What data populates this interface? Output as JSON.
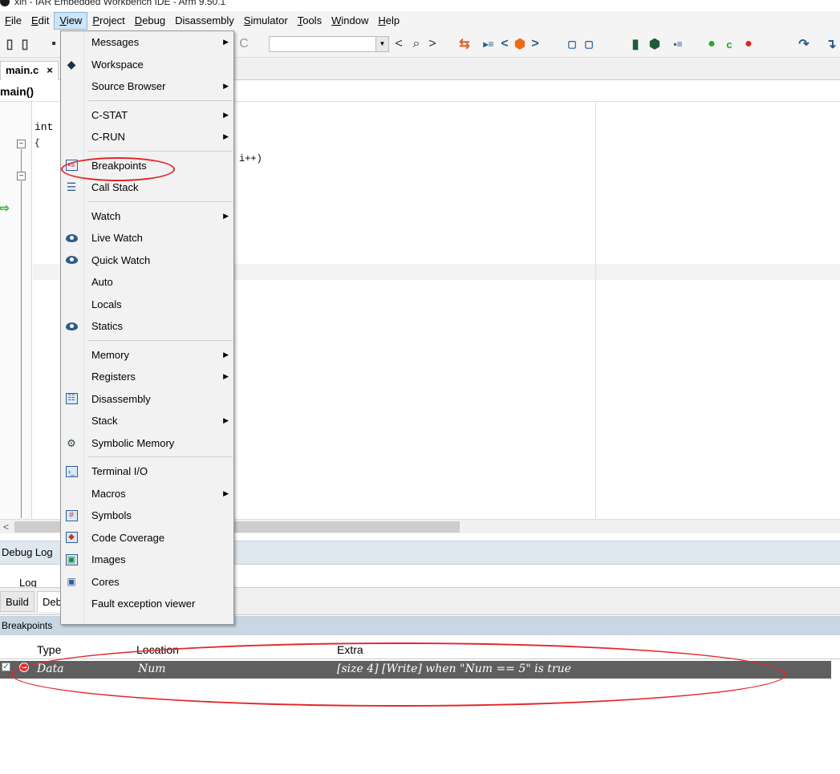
{
  "window": {
    "title": "xin - IAR Embedded Workbench IDE - Arm 9.50.1"
  },
  "menubar": [
    {
      "label": "File",
      "ul": "F",
      "rest": "ile",
      "active": false
    },
    {
      "label": "Edit",
      "ul": "E",
      "rest": "dit",
      "active": false
    },
    {
      "label": "View",
      "ul": "V",
      "rest": "iew",
      "active": true
    },
    {
      "label": "Project",
      "ul": "P",
      "rest": "roject",
      "active": false
    },
    {
      "label": "Debug",
      "ul": "D",
      "rest": "ebug",
      "active": false
    },
    {
      "label": "Disassembly",
      "ul": "",
      "rest": "Disassembly",
      "active": false
    },
    {
      "label": "Simulator",
      "ul": "S",
      "rest": "imulator",
      "active": false
    },
    {
      "label": "Tools",
      "ul": "T",
      "rest": "ools",
      "active": false
    },
    {
      "label": "Window",
      "ul": "W",
      "rest": "indow",
      "active": false
    },
    {
      "label": "Help",
      "ul": "H",
      "rest": "elp",
      "active": false
    }
  ],
  "editor": {
    "file_tab": "main.c",
    "close_glyph": "×",
    "function_scope": "main()",
    "code_int": "int",
    "code_brace": "{",
    "code_loop_tail": "i++)"
  },
  "view_menu": [
    {
      "label": "Messages",
      "submenu": true,
      "icon": ""
    },
    {
      "label": "Workspace",
      "submenu": false,
      "icon": "workspace-icon"
    },
    {
      "label": "Source Browser",
      "submenu": true,
      "icon": ""
    },
    {
      "sep": true
    },
    {
      "label": "C-STAT",
      "submenu": true,
      "icon": ""
    },
    {
      "label": "C-RUN",
      "submenu": true,
      "icon": ""
    },
    {
      "sep": true
    },
    {
      "label": "Breakpoints",
      "submenu": false,
      "icon": "breakpoints-icon"
    },
    {
      "label": "Call Stack",
      "submenu": false,
      "icon": "call-stack-icon"
    },
    {
      "sep": true
    },
    {
      "label": "Watch",
      "submenu": true,
      "icon": ""
    },
    {
      "label": "Live Watch",
      "submenu": false,
      "icon": "live-watch-icon"
    },
    {
      "label": "Quick Watch",
      "submenu": false,
      "icon": "quick-watch-icon"
    },
    {
      "label": "Auto",
      "submenu": false,
      "icon": ""
    },
    {
      "label": "Locals",
      "submenu": false,
      "icon": ""
    },
    {
      "label": "Statics",
      "submenu": false,
      "icon": "statics-icon"
    },
    {
      "sep": true
    },
    {
      "label": "Memory",
      "submenu": true,
      "icon": ""
    },
    {
      "label": "Registers",
      "submenu": true,
      "icon": ""
    },
    {
      "label": "Disassembly",
      "submenu": false,
      "icon": "disassembly-icon"
    },
    {
      "label": "Stack",
      "submenu": true,
      "icon": ""
    },
    {
      "label": "Symbolic Memory",
      "submenu": false,
      "icon": "symbolic-memory-icon"
    },
    {
      "sep": true
    },
    {
      "label": "Terminal I/O",
      "submenu": false,
      "icon": "terminal-icon"
    },
    {
      "label": "Macros",
      "submenu": true,
      "icon": ""
    },
    {
      "label": "Symbols",
      "submenu": false,
      "icon": "symbols-icon"
    },
    {
      "label": "Code Coverage",
      "submenu": false,
      "icon": "code-coverage-icon"
    },
    {
      "label": "Images",
      "submenu": false,
      "icon": "images-icon"
    },
    {
      "label": "Cores",
      "submenu": false,
      "icon": "cores-icon"
    },
    {
      "label": "Fault exception viewer",
      "submenu": false,
      "icon": ""
    }
  ],
  "panels": {
    "debug_log": "Debug Log",
    "log_col": "Log",
    "tab_build": "Build",
    "tab_debug": "Deb",
    "breakpoints_title": "Breakpoints"
  },
  "breakpoints_table": {
    "columns": [
      "Type",
      "Location",
      "Extra"
    ],
    "rows": [
      {
        "checked": true,
        "type": "Data",
        "location": "Num",
        "extra": "[size 4] [Write] when \"Num == 5\" is true"
      }
    ]
  },
  "colors": {
    "accent_highlight": "#cce4f7",
    "annotation_red": "#e3262a",
    "selected_row": "#5f5f5f"
  }
}
